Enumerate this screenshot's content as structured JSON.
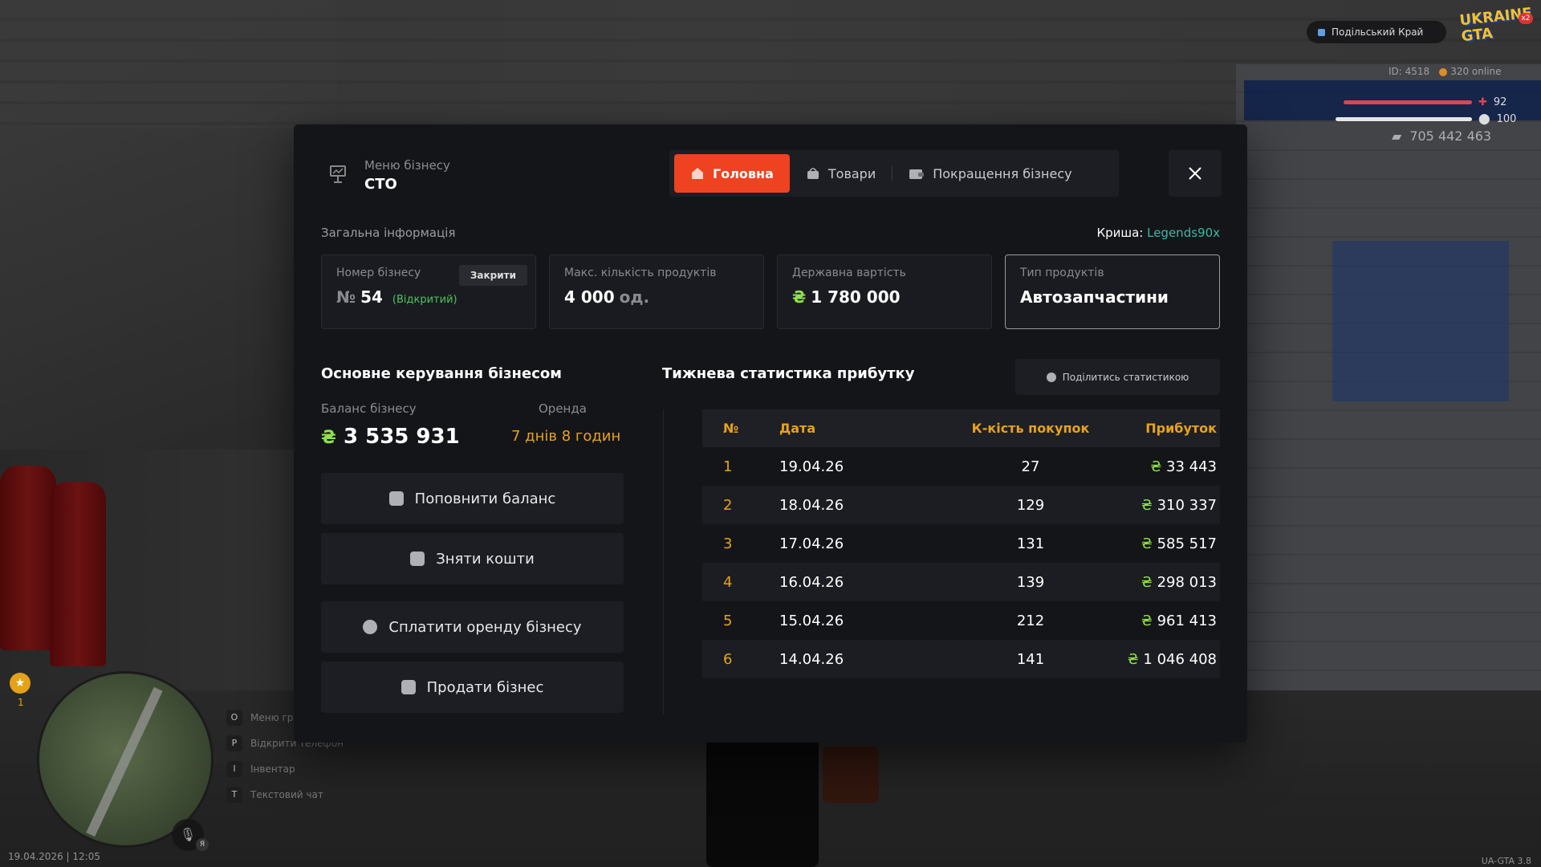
{
  "hud": {
    "server_name": "Подільський Край",
    "logo_text": "UKRAINE GTA",
    "logo_badge": "x2",
    "player_id": "ID: 4518",
    "online": "320 online",
    "health": "92",
    "armor": "100",
    "money": "705 442 463",
    "wanted_level": "1",
    "datetime": "19.04.2026 | 12:05",
    "version": "UA-GTA 3.8",
    "mic_label": "Я",
    "hotkeys": [
      {
        "key": "O",
        "label": "Меню гравця"
      },
      {
        "key": "P",
        "label": "Відкрити телефон"
      },
      {
        "key": "I",
        "label": "Інвентар"
      },
      {
        "key": "T",
        "label": "Текстовий чат"
      }
    ]
  },
  "modal": {
    "caption": "Меню бізнесу",
    "title": "СТО",
    "tabs": [
      {
        "label": "Головна",
        "icon": "home-icon",
        "active": true
      },
      {
        "label": "Товари",
        "icon": "basket-icon",
        "active": false
      },
      {
        "label": "Покращення бізнесу",
        "icon": "wallet-icon",
        "active": false
      }
    ],
    "general_info_label": "Загальна інформація",
    "roof_label": "Криша:",
    "roof_value": "Legends90x",
    "cards": {
      "number": {
        "label": "Номер бізнесу",
        "prefix": "№",
        "value": "54",
        "status": "(Відкритий)",
        "close_button": "Закрити"
      },
      "max_products": {
        "label": "Макс. кількість продуктів",
        "value": "4 000",
        "unit": "од."
      },
      "state_value": {
        "label": "Державна вартість",
        "currency": "₴",
        "value": "1 780 000"
      },
      "product_type": {
        "label": "Тип продуктів",
        "value": "Автозапчастини"
      }
    },
    "management": {
      "title": "Основне керування бізнесом",
      "balance_label": "Баланс бізнесу",
      "balance_currency": "₴",
      "balance_value": "3 535 931",
      "rent_label": "Оренда",
      "rent_value": "7 днів 8 годин",
      "buttons": {
        "deposit": "Поповнити баланс",
        "withdraw": "Зняти кошти",
        "pay_rent": "Сплатити оренду бізнесу",
        "sell": "Продати бізнес"
      }
    },
    "stats": {
      "title": "Тижнева статистика прибутку",
      "share_button": "Поділитись статистикою",
      "columns": [
        "№",
        "Дата",
        "К-кість покупок",
        "Прибуток"
      ],
      "currency": "₴",
      "rows": [
        {
          "no": "1",
          "date": "19.04.26",
          "count": "27",
          "profit": "33 443"
        },
        {
          "no": "2",
          "date": "18.04.26",
          "count": "129",
          "profit": "310 337"
        },
        {
          "no": "3",
          "date": "17.04.26",
          "count": "131",
          "profit": "585 517"
        },
        {
          "no": "4",
          "date": "16.04.26",
          "count": "139",
          "profit": "298 013"
        },
        {
          "no": "5",
          "date": "15.04.26",
          "count": "212",
          "profit": "961 413"
        },
        {
          "no": "6",
          "date": "14.04.26",
          "count": "141",
          "profit": "1 046 408"
        }
      ]
    }
  },
  "colors": {
    "accent": "#ee4221",
    "orange": "#e8a21a",
    "green_currency": "#8fe04a",
    "teal": "#3cb9a5",
    "panel": "#141519"
  }
}
